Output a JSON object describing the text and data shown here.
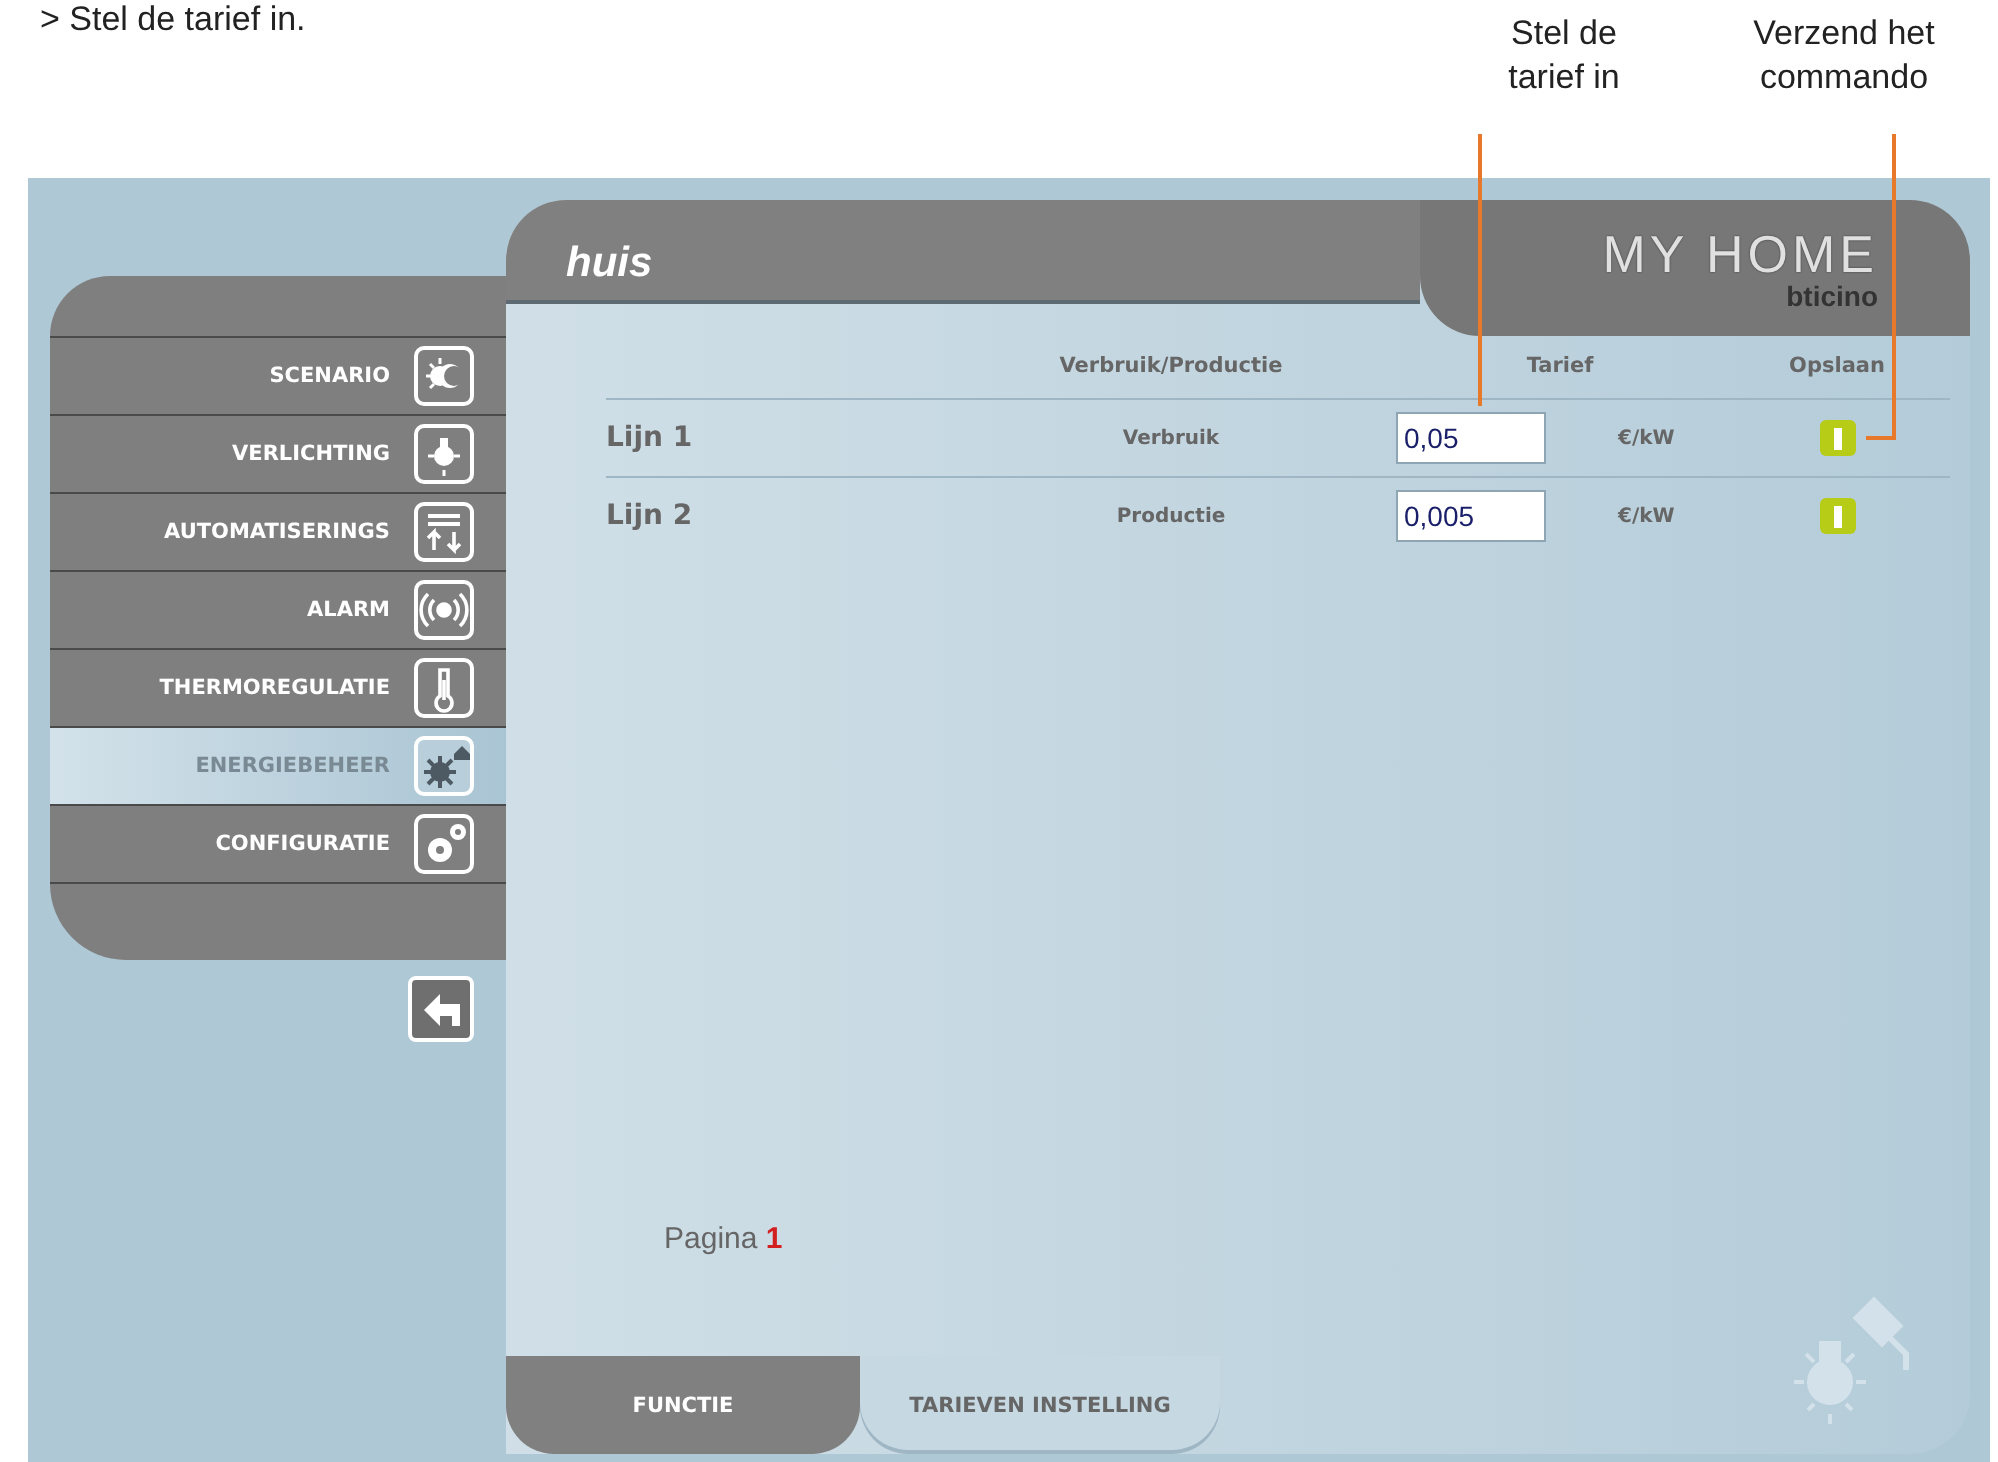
{
  "instruction": "> Stel de tarief in.",
  "callouts": [
    {
      "text": "Stel de tarief in"
    },
    {
      "text": "Verzend het commando"
    }
  ],
  "sidebar": {
    "items": [
      {
        "label": "SCENARIO",
        "selected": false
      },
      {
        "label": "VERLICHTING",
        "selected": false
      },
      {
        "label": "AUTOMATISERINGS",
        "selected": false
      },
      {
        "label": "ALARM",
        "selected": false
      },
      {
        "label": "THERMOREGULATIE",
        "selected": false
      },
      {
        "label": "ENERGIEBEHEER",
        "selected": true
      },
      {
        "label": "CONFIGURATIE",
        "selected": false
      }
    ]
  },
  "header": {
    "title": "huis",
    "logo": "MY HOME",
    "brand": "bticino"
  },
  "table": {
    "columns": [
      "Verbruik/Productie",
      "Tarief",
      "Opslaan"
    ],
    "rows": [
      {
        "name": "Lijn 1",
        "type": "Verbruik",
        "value": "0,05",
        "unit": "€/kW"
      },
      {
        "name": "Lijn 2",
        "type": "Productie",
        "value": "0,005",
        "unit": "€/kW"
      }
    ]
  },
  "pagination": {
    "label": "Pagina",
    "page": "1"
  },
  "tabs": [
    {
      "label": "FUNCTIE",
      "selected": false
    },
    {
      "label": "TARIEVEN INSTELLING",
      "selected": true
    }
  ]
}
